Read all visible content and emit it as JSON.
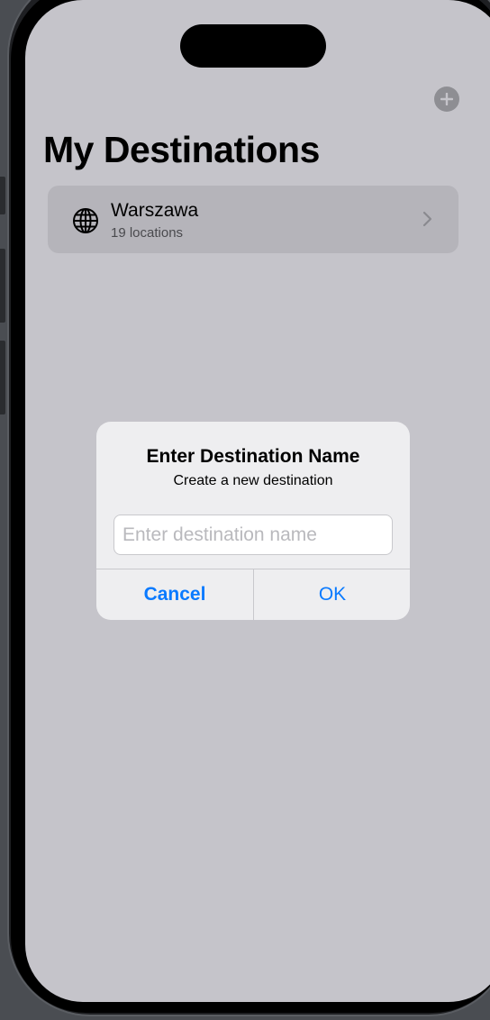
{
  "colors": {
    "accent": "#0a7aff",
    "screen_background": "#c5c4ca",
    "card_background": "#b5b4ba",
    "alert_background": "#eeeef0"
  },
  "toolbar": {
    "add_icon": "plus-circle-icon"
  },
  "header": {
    "title": "My Destinations"
  },
  "destinations": [
    {
      "icon": "globe-icon",
      "name": "Warszawa",
      "subtitle": "19 locations",
      "accessory": "chevron-right-icon"
    }
  ],
  "alert": {
    "title": "Enter Destination Name",
    "message": "Create a new destination",
    "input": {
      "value": "",
      "placeholder": "Enter destination name"
    },
    "cancel_label": "Cancel",
    "ok_label": "OK"
  }
}
